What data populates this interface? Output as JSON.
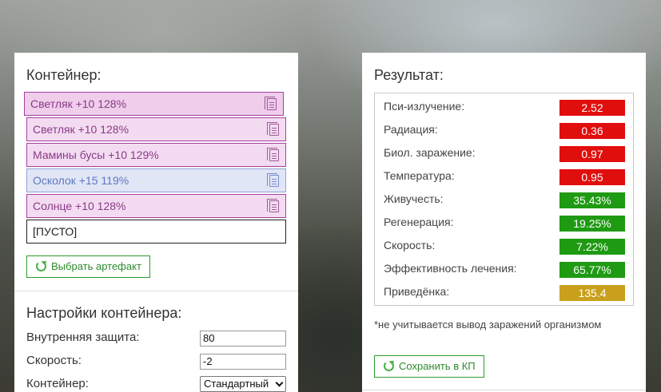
{
  "container": {
    "title": "Контейнер:",
    "slots": [
      {
        "label": "Светляк +10 128%",
        "style": "pink-sel"
      },
      {
        "label": "Светляк +10 128%",
        "style": "pink"
      },
      {
        "label": "Мамины бусы +10 129%",
        "style": "pink"
      },
      {
        "label": "Осколок +15 119%",
        "style": "blue"
      },
      {
        "label": "Солнце +10 128%",
        "style": "pink"
      },
      {
        "label": "[ПУСТО]",
        "style": "empty"
      }
    ],
    "pick_button": "Выбрать артефакт",
    "icons": {
      "slot": "document-icon",
      "button": "refresh-icon"
    }
  },
  "settings": {
    "title": "Настройки контейнера:",
    "inner_protection_label": "Внутренняя защита:",
    "inner_protection_value": "80",
    "speed_label": "Скорость:",
    "speed_value": "-2",
    "container_label": "Контейнер:",
    "container_value": "Стандартный"
  },
  "result": {
    "title": "Результат:",
    "rows": [
      {
        "label": "Пси-излучение:",
        "value": "2.52",
        "color": "#e10e0e"
      },
      {
        "label": "Радиация:",
        "value": "0.36",
        "color": "#e10e0e"
      },
      {
        "label": "Биол. заражение:",
        "value": "0.97",
        "color": "#e10e0e"
      },
      {
        "label": "Температура:",
        "value": "0.95",
        "color": "#e10e0e"
      },
      {
        "label": "Живучесть:",
        "value": "35.43%",
        "color": "#1f9a13"
      },
      {
        "label": "Регенерация:",
        "value": "19.25%",
        "color": "#1f9a13"
      },
      {
        "label": "Скорость:",
        "value": "7.22%",
        "color": "#1f9a13"
      },
      {
        "label": "Эффективность лечения:",
        "value": "65.77%",
        "color": "#1f9a13"
      },
      {
        "label": "Приведёнка:",
        "value": "135.4",
        "color": "#c9a01c"
      }
    ],
    "footnote": "*не учитывается вывод заражений организмом",
    "save_button": "Сохранить в КП"
  }
}
